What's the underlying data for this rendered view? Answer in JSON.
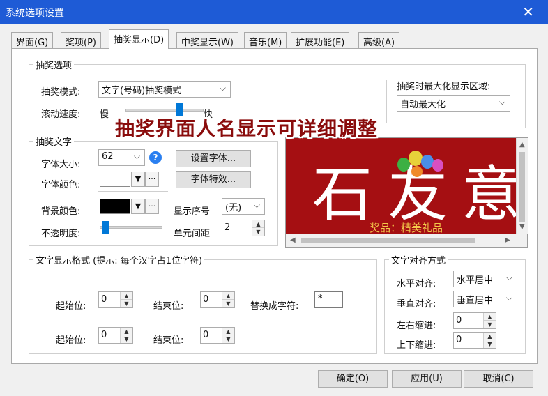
{
  "window": {
    "title": "系统选项设置",
    "close_label": "✕"
  },
  "tabs": [
    {
      "label": "界面(G)"
    },
    {
      "label": "奖项(P)"
    },
    {
      "label": "抽奖显示(D)"
    },
    {
      "label": "中奖显示(W)"
    },
    {
      "label": "音乐(M)"
    },
    {
      "label": "扩展功能(E)"
    },
    {
      "label": "高级(A)"
    }
  ],
  "draw_options": {
    "title": "抽奖选项",
    "mode_label": "抽奖模式:",
    "mode_value": "文字(号码)抽奖模式",
    "speed_label": "滚动速度:",
    "speed_slow": "慢",
    "speed_fast": "快",
    "speed_level": 0.75,
    "maximize_label": "抽奖时最大化显示区域:",
    "maximize_value": "自动最大化"
  },
  "banner_text": "抽奖界面人名显示可详细调整",
  "draw_text": {
    "title": "抽奖文字",
    "font_size_label": "字体大小:",
    "font_size_value": "62",
    "set_font_button": "设置字体...",
    "font_color_label": "字体颜色:",
    "font_color": "#ffffff",
    "font_effect_button": "字体特效...",
    "bg_color_label": "背景颜色:",
    "bg_color": "#000000",
    "show_index_label": "显示序号",
    "show_index_value": "(无)",
    "opacity_label": "不透明度:",
    "opacity_level": 0.04,
    "cell_spacing_label": "单元间距",
    "cell_spacing_value": "2",
    "more_button": "···",
    "dropdown_arrow": "▼"
  },
  "preview": {
    "glyphs": [
      "石",
      "友",
      "意"
    ],
    "subtitle": "奖品：精美礼品",
    "background": "#a50f12"
  },
  "format": {
    "title": "文字显示格式 (提示: 每个汉字占1位字符)",
    "start_label": "起始位:",
    "end_label": "结束位:",
    "replace_label": "替换成字符:",
    "row1_start": "0",
    "row1_end": "0",
    "replace_value": "*",
    "row2_start": "0",
    "row2_end": "0"
  },
  "align": {
    "title": "文字对齐方式",
    "h_label": "水平对齐:",
    "h_value": "水平居中",
    "v_label": "垂直对齐:",
    "v_value": "垂直居中",
    "lr_indent_label": "左右缩进:",
    "lr_indent_value": "0",
    "tb_indent_label": "上下缩进:",
    "tb_indent_value": "0"
  },
  "footer": {
    "ok": "确定(O)",
    "apply": "应用(U)",
    "cancel": "取消(C)"
  },
  "icons": {
    "help": "?",
    "combo_arrow": "⌵",
    "spin_up": "▲",
    "spin_down": "▼"
  }
}
